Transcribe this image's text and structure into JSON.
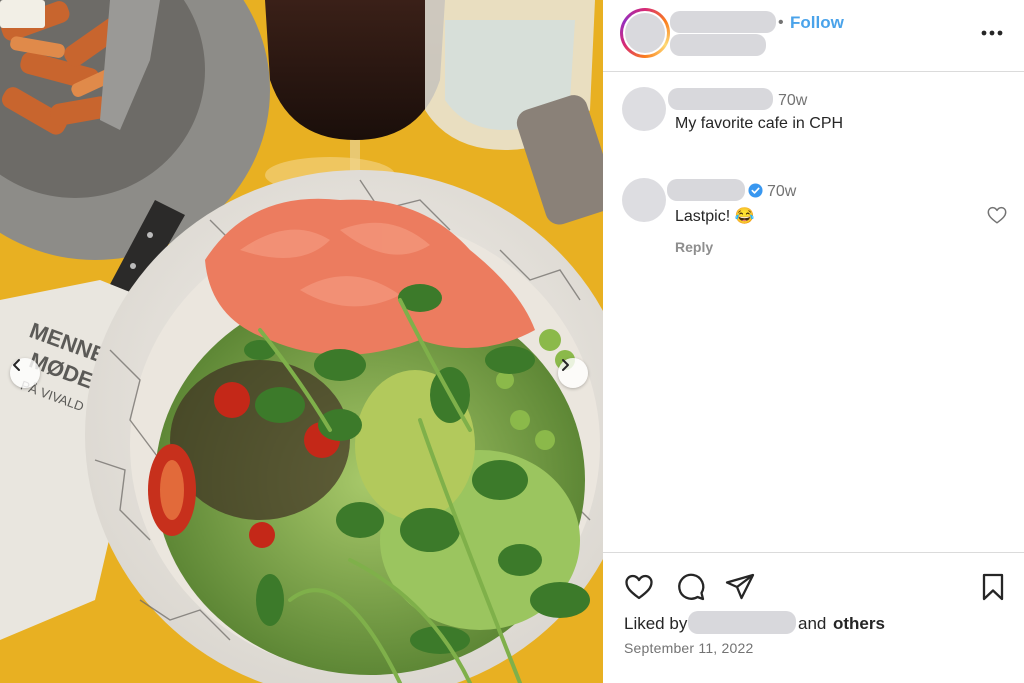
{
  "post": {
    "photo_alt": "Salad with smoked salmon and pea shoots",
    "napkin_text": [
      "MENNE",
      "MØDE",
      "PÅ VIVALD"
    ]
  },
  "header": {
    "separator": "•",
    "follow_label": "Follow",
    "more_icon": "more-horizontal-icon"
  },
  "comments": [
    {
      "time": "70w",
      "text": "My favorite cafe in CPH",
      "verified": false
    },
    {
      "time": "70w",
      "text": "Lastpic! 😂",
      "verified": true,
      "reply_label": "Reply"
    }
  ],
  "footer": {
    "actions": [
      "heart-icon",
      "comment-icon",
      "share-icon",
      "bookmark-icon"
    ],
    "liked_by_prefix": "Liked by",
    "liked_by_mid": "and",
    "liked_by_others": "others",
    "date": "September 11, 2022"
  },
  "colors": {
    "follow": "#4aa3ea",
    "verified": "#3897f0",
    "muted": "#737373",
    "redaction": "#d8d8dc"
  }
}
